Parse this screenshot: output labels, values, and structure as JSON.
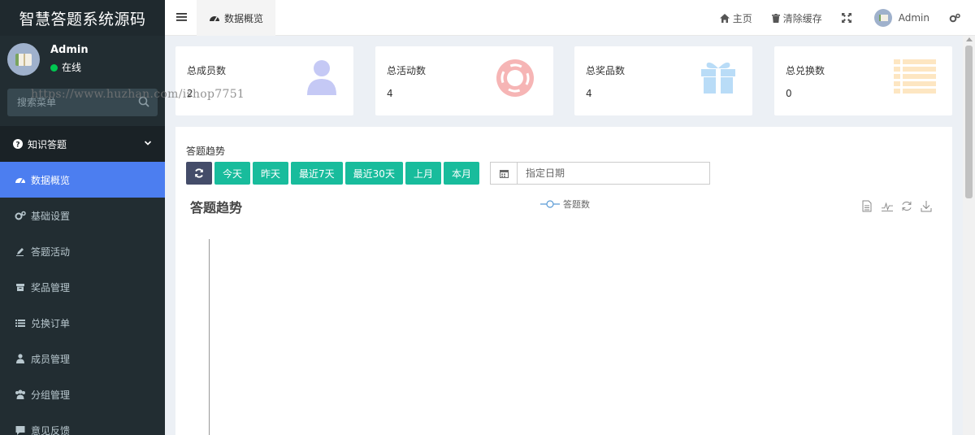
{
  "sidebar": {
    "brand": "智慧答题系统源码",
    "user": {
      "name": "Admin",
      "status": "在线"
    },
    "search": {
      "placeholder": "搜索菜单"
    },
    "menu_header": "知识答题",
    "items": [
      {
        "label": "数据概览",
        "icon": "dashboard-icon",
        "active": true
      },
      {
        "label": "基础设置",
        "icon": "cogs-icon"
      },
      {
        "label": "答题活动",
        "icon": "pencil-icon"
      },
      {
        "label": "奖品管理",
        "icon": "archive-icon"
      },
      {
        "label": "兑换订单",
        "icon": "list-icon"
      },
      {
        "label": "成员管理",
        "icon": "user-icon"
      },
      {
        "label": "分组管理",
        "icon": "users-icon"
      },
      {
        "label": "意见反馈",
        "icon": "comment-icon"
      }
    ]
  },
  "header": {
    "tab": "数据概览",
    "nav": {
      "home": "主页",
      "clear_cache": "清除缓存",
      "user": "Admin"
    }
  },
  "stats": [
    {
      "title": "总成员数",
      "value": "2",
      "icon": "user-icon",
      "color": "#c5c9f5"
    },
    {
      "title": "总活动数",
      "value": "4",
      "icon": "life-ring-icon",
      "color": "#f6b5b5"
    },
    {
      "title": "总奖品数",
      "value": "4",
      "icon": "gift-icon",
      "color": "#b9dcf7"
    },
    {
      "title": "总兑换数",
      "value": "0",
      "icon": "list-icon",
      "color": "#fde6c2"
    }
  ],
  "panel": {
    "title": "答题趋势",
    "buttons": [
      "今天",
      "昨天",
      "最近7天",
      "最近30天",
      "上月",
      "本月"
    ],
    "date_placeholder": "指定日期",
    "chart_title": "答题趋势",
    "legend": "答题数"
  },
  "watermark": "https://www.huzhan.com/ishop7751",
  "colors": {
    "sidebar": "#222d32",
    "active": "#4c7ef0",
    "button": "#18bc9c",
    "refresh": "#444c69"
  }
}
